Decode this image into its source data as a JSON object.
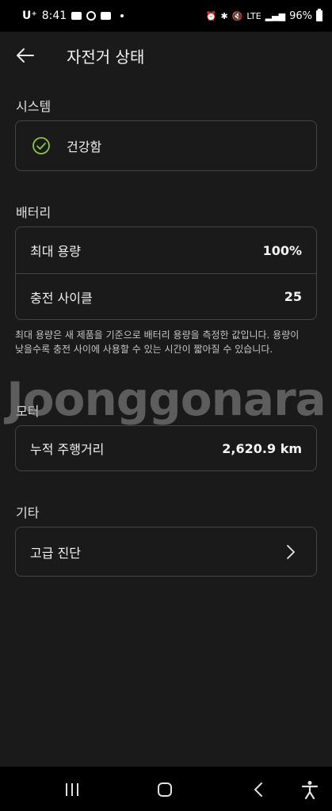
{
  "status_bar": {
    "carrier": "U⁺",
    "time": "8:41",
    "network": "LTE",
    "battery": "96%"
  },
  "header": {
    "title": "자전거 상태"
  },
  "system": {
    "label": "시스템",
    "status": "건강함"
  },
  "battery": {
    "label": "배터리",
    "rows": [
      {
        "label": "최대 용량",
        "value": "100%"
      },
      {
        "label": "충전 사이클",
        "value": "25"
      }
    ],
    "note": "최대 용량은 새 제품을 기준으로 배터리 용량을 측정한 값입니다. 용량이 낮을수록 충전 사이에 사용할 수 있는 시간이 짧아질 수 있습니다."
  },
  "motor": {
    "label": "모터",
    "rows": [
      {
        "label": "누적 주행거리",
        "value": "2,620.9 km"
      }
    ]
  },
  "other": {
    "label": "기타",
    "rows": [
      {
        "label": "고급 진단"
      }
    ]
  },
  "watermark": "Joonggonara"
}
